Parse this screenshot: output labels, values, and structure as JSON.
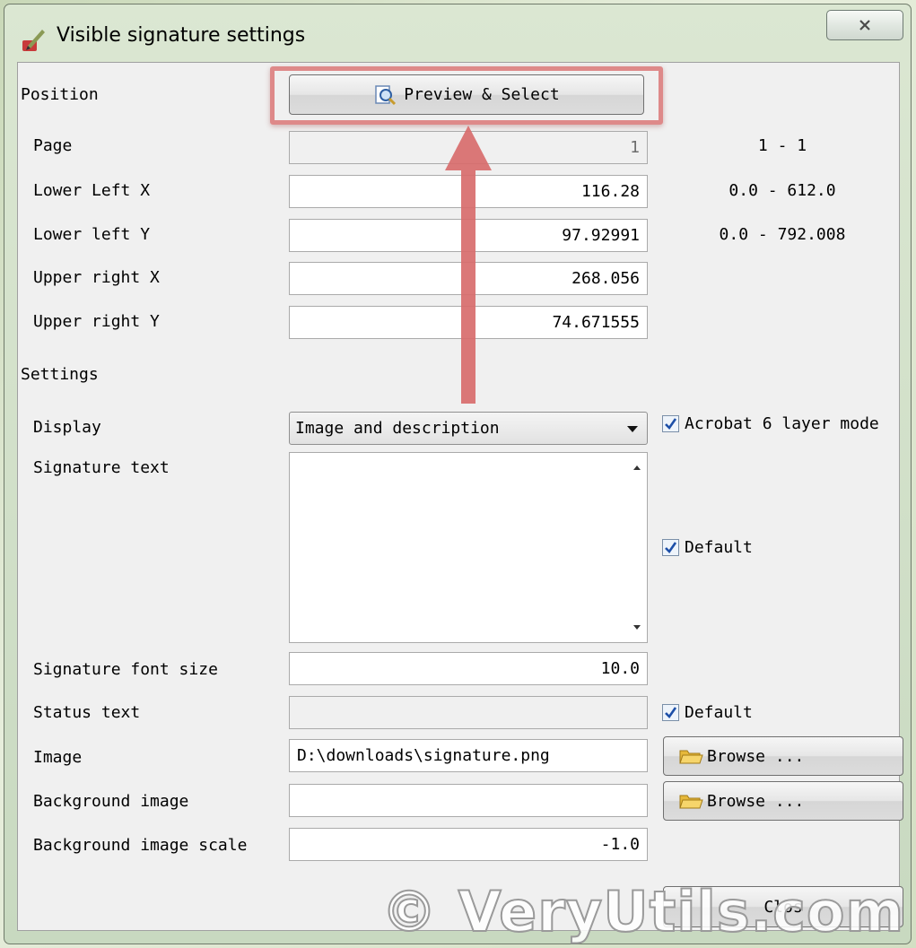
{
  "window": {
    "title": "Visible signature settings"
  },
  "position": {
    "section_label": "Position",
    "preview_button_label": "Preview & Select",
    "fields": [
      {
        "label": "Page",
        "value": "1",
        "range": "1 - 1"
      },
      {
        "label": "Lower Left X",
        "value": "116.28",
        "range": "0.0 - 612.0"
      },
      {
        "label": "Lower left Y",
        "value": "97.92991",
        "range": "0.0 - 792.008"
      },
      {
        "label": "Upper right X",
        "value": "268.056",
        "range": ""
      },
      {
        "label": "Upper right Y",
        "value": "74.671555",
        "range": ""
      }
    ]
  },
  "settings": {
    "section_label": "Settings",
    "display_label": "Display",
    "display_value": "Image and description",
    "acrobat_checkbox_label": "Acrobat 6 layer mode",
    "signature_text_label": "Signature text",
    "signature_text_value": "",
    "signature_text_default_label": "Default",
    "font_size_label": "Signature font size",
    "font_size_value": "10.0",
    "status_text_label": "Status text",
    "status_text_value": "",
    "status_default_label": "Default",
    "image_label": "Image",
    "image_value": "D:\\downloads\\signature.png",
    "image_browse_label": "Browse ...",
    "bg_image_label": "Background image",
    "bg_image_value": "",
    "bg_browse_label": "Browse ...",
    "bg_scale_label": "Background image scale",
    "bg_scale_value": "-1.0"
  },
  "footer": {
    "close_label": "Clos"
  },
  "watermark": "© VeryUtils.com",
  "colors": {
    "highlight": "#de8989",
    "arrow": "#d86c6c",
    "check": "#1d4fa8"
  }
}
